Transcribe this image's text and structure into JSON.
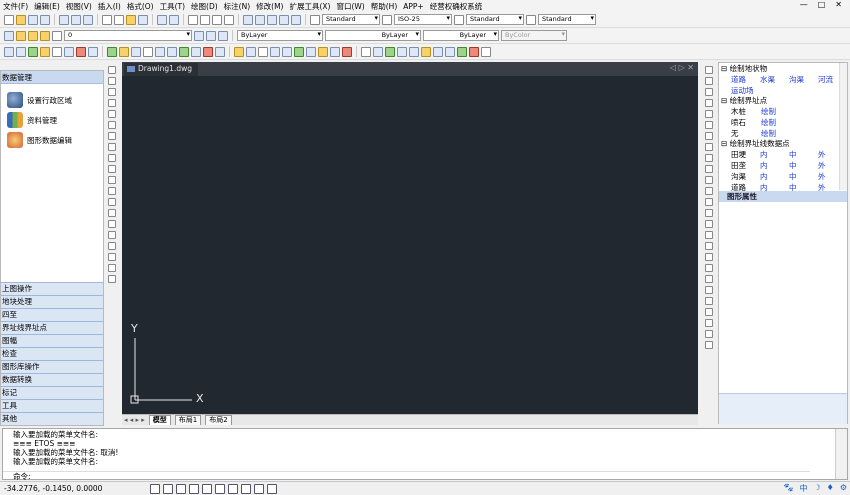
{
  "menu": [
    "文件(F)",
    "编辑(E)",
    "视图(V)",
    "插入(I)",
    "格式(O)",
    "工具(T)",
    "绘图(D)",
    "标注(N)",
    "修改(M)",
    "扩展工具(X)",
    "窗口(W)",
    "帮助(H)",
    "APP+",
    "经营权确权系统"
  ],
  "window_controls": [
    "—",
    "□",
    "✕"
  ],
  "toolbar1": {
    "text_style": "Standard",
    "dim_style": "ISO-25",
    "table_style": "Standard",
    "multileader_style": "Standard"
  },
  "toolbar2": {
    "layer": "0",
    "color": "ByLayer",
    "linetype": "ByLayer",
    "lineweight": "ByLayer",
    "plotstyle": "ByColor"
  },
  "left_panel": {
    "title": "数据管理",
    "items": [
      {
        "label": "设置行政区域",
        "icon": "globe-icon"
      },
      {
        "label": "资料管理",
        "icon": "chart-icon"
      },
      {
        "label": "图形数据编辑",
        "icon": "palette-icon"
      }
    ],
    "categories": [
      "上图操作",
      "地块处理",
      "四至",
      "界址线界址点",
      "图幅",
      "检查",
      "图形库操作",
      "数据转换",
      "标记",
      "工具",
      "其他"
    ]
  },
  "drawing": {
    "tab_title": "Drawing1.dwg",
    "nav": "◁ ▷ ✕",
    "layout_tabs": [
      "模型",
      "布局1",
      "布局2"
    ],
    "ucs_x": "X",
    "ucs_y": "Y"
  },
  "right_panel": {
    "groups": [
      {
        "title": "绘制地状物",
        "rows": [
          [
            "道路",
            "水渠",
            "沟渠",
            "河流"
          ],
          [
            "运动场"
          ]
        ]
      },
      {
        "title": "绘制界址点",
        "rows": [
          [
            "木桩",
            "绘制"
          ],
          [
            "喷石",
            "绘制"
          ],
          [
            "无",
            "绘制"
          ]
        ]
      },
      {
        "title": "绘制界址线数据点",
        "rows": [
          [
            "田埂",
            "内",
            "中",
            "外"
          ],
          [
            "田垄",
            "内",
            "中",
            "外"
          ],
          [
            "沟渠",
            "内",
            "中",
            "外"
          ],
          [
            "道路",
            "内",
            "中",
            "外"
          ]
        ]
      }
    ],
    "properties_title": "图形属性"
  },
  "command": {
    "lines": [
      "输入要加载的菜单文件名:",
      "≡≡≡  ETOS  ≡≡≡",
      "输入要加载的菜单文件名: 取消!",
      "输入要加载的菜单文件名:"
    ],
    "prompt": "命令:"
  },
  "status": {
    "coords": "-34.2776,  -0.1450,  0.0000",
    "right_items": [
      "中",
      "☽",
      "♦",
      "⚙"
    ]
  }
}
